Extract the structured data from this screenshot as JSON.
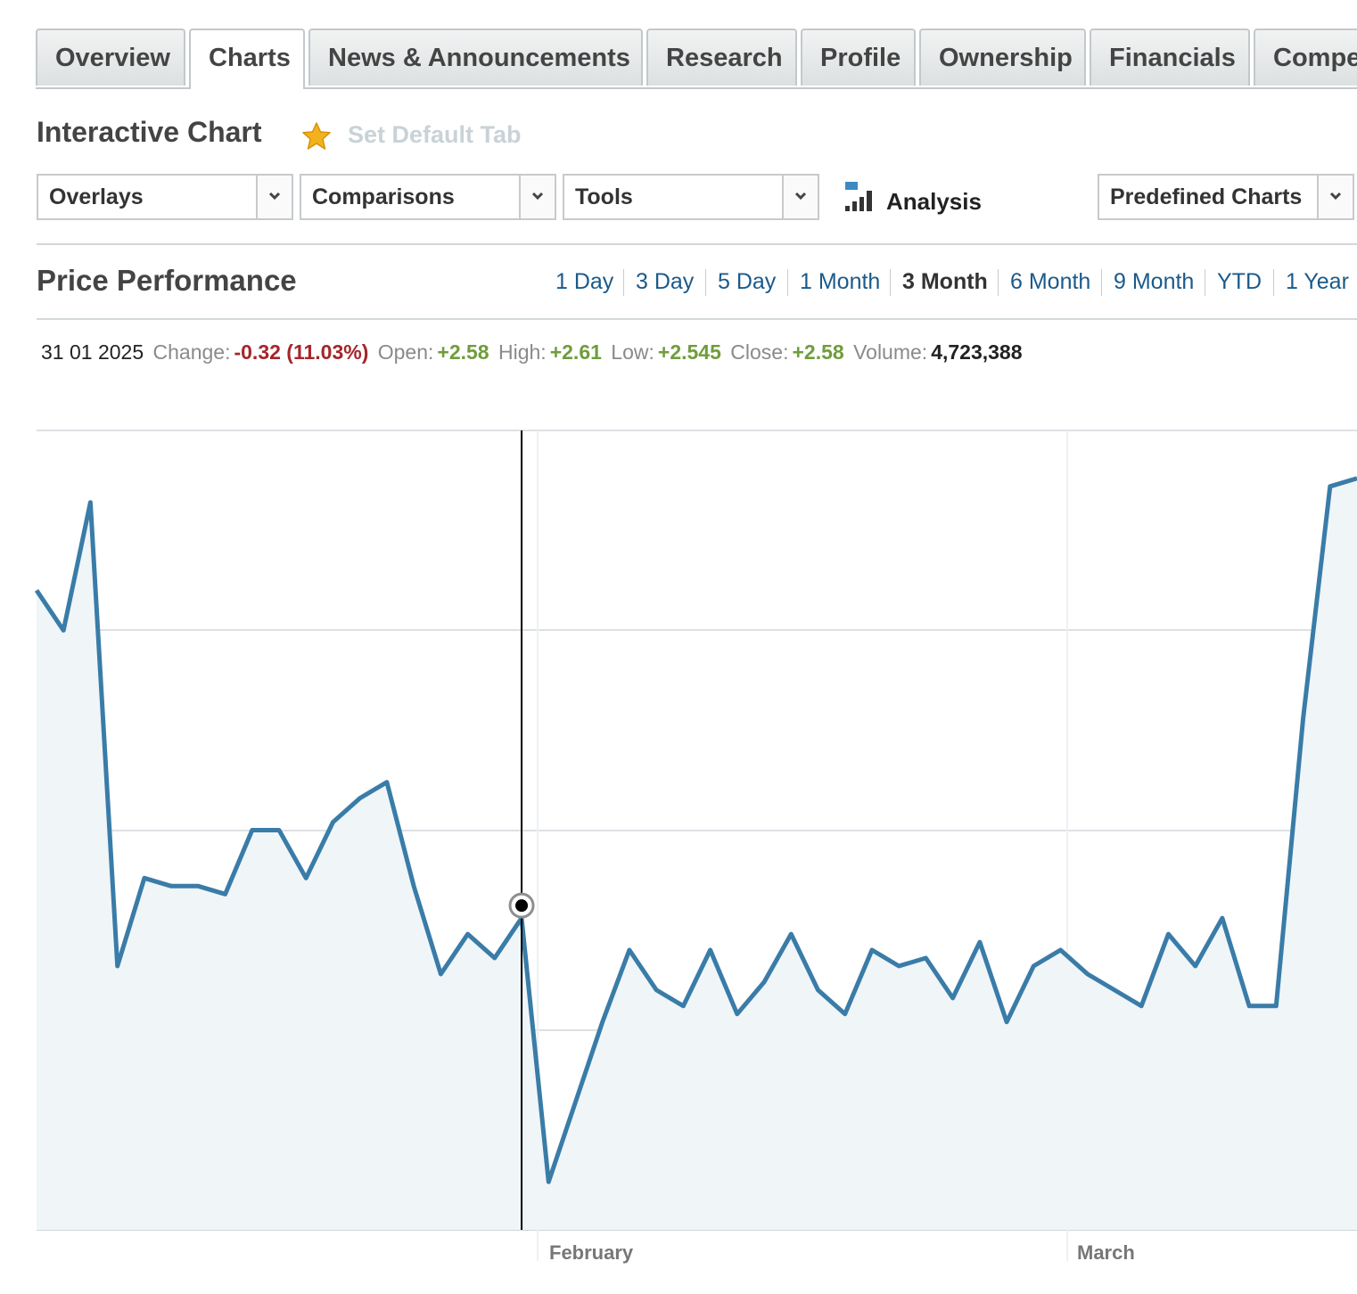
{
  "tabs": [
    {
      "label": "Overview"
    },
    {
      "label": "Charts"
    },
    {
      "label": "News & Announcements"
    },
    {
      "label": "Research"
    },
    {
      "label": "Profile"
    },
    {
      "label": "Ownership"
    },
    {
      "label": "Financials"
    },
    {
      "label": "Compe"
    }
  ],
  "active_tab": "Charts",
  "header": {
    "title": "Interactive Chart",
    "default_tab_label": "Set Default Tab"
  },
  "toolbar": {
    "overlays": "Overlays",
    "comparisons": "Comparisons",
    "tools": "Tools",
    "analysis": "Analysis",
    "predefined": "Predefined Charts"
  },
  "performance": {
    "title": "Price Performance",
    "periods": [
      "1 Day",
      "3 Day",
      "5 Day",
      "1 Month",
      "3 Month",
      "6 Month",
      "9 Month",
      "YTD",
      "1 Year"
    ],
    "selected": "3 Month"
  },
  "info": {
    "date": "31 01 2025",
    "change_label": "Change:",
    "change_value": "-0.32 (11.03%)",
    "open_label": "Open:",
    "open_value": "+2.58",
    "high_label": "High:",
    "high_value": "+2.61",
    "low_label": "Low:",
    "low_value": "+2.545",
    "close_label": "Close:",
    "close_value": "+2.58",
    "volume_label": "Volume:",
    "volume_value": "4,723,388"
  },
  "colors": {
    "line": "#3a7ca8",
    "fill": "#f0f5f8",
    "negative": "#a4262a",
    "positive": "#6f9d3c",
    "link": "#1b5a8a"
  },
  "chart_data": {
    "type": "area",
    "x_labels": [
      "February",
      "March"
    ],
    "grid": true,
    "crosshair_index": 18,
    "y_relative": [
      0.8,
      0.75,
      0.91,
      0.33,
      0.44,
      0.43,
      0.43,
      0.42,
      0.5,
      0.5,
      0.44,
      0.51,
      0.54,
      0.56,
      0.43,
      0.32,
      0.37,
      0.34,
      0.39,
      0.06,
      0.16,
      0.26,
      0.35,
      0.3,
      0.28,
      0.35,
      0.27,
      0.31,
      0.37,
      0.3,
      0.27,
      0.35,
      0.33,
      0.34,
      0.29,
      0.36,
      0.26,
      0.33,
      0.35,
      0.32,
      0.3,
      0.28,
      0.37,
      0.33,
      0.39,
      0.28,
      0.28,
      0.64,
      0.93,
      0.94
    ]
  }
}
